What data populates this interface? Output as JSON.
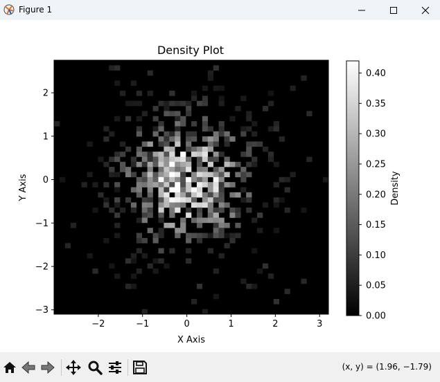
{
  "window": {
    "title": "Figure 1"
  },
  "icons": {
    "app": "matplotlib-icon",
    "minimize": "minimize-icon",
    "maximize": "maximize-icon",
    "close": "close-icon",
    "home": "home-icon",
    "back": "back-arrow-icon",
    "forward": "forward-arrow-icon",
    "pan": "pan-icon",
    "zoom": "zoom-icon",
    "configure": "configure-subplots-icon",
    "save": "save-icon"
  },
  "toolbar": {
    "coords": "(x, y) = (1.96, −1.79)"
  },
  "chart_data": {
    "type": "heatmap",
    "title": "Density Plot",
    "xlabel": "X Axis",
    "ylabel": "Y Axis",
    "colorbar_label": "Density",
    "colormap": "gray",
    "xlim": [
      -3.0,
      3.2
    ],
    "ylim": [
      -3.1,
      2.75
    ],
    "xticks": [
      -2,
      -1,
      0,
      1,
      2,
      3
    ],
    "xtick_labels": [
      "−2",
      "−1",
      "0",
      "1",
      "2",
      "3"
    ],
    "yticks": [
      -3,
      -2,
      -1,
      0,
      1,
      2
    ],
    "ytick_labels": [
      "−3",
      "−2",
      "−1",
      "0",
      "1",
      "2"
    ],
    "colorbar": {
      "min": 0.0,
      "max": 0.42,
      "ticks": [
        0.0,
        0.05,
        0.1,
        0.15,
        0.2,
        0.25,
        0.3,
        0.35,
        0.4
      ],
      "tick_labels": [
        "0.00",
        "0.05",
        "0.10",
        "0.15",
        "0.20",
        "0.25",
        "0.30",
        "0.35",
        "0.40"
      ]
    },
    "bins": [
      50,
      50
    ],
    "distribution": "approximately bivariate normal centered near (0, 0), sd ≈ 1",
    "peak_density": 0.42
  }
}
